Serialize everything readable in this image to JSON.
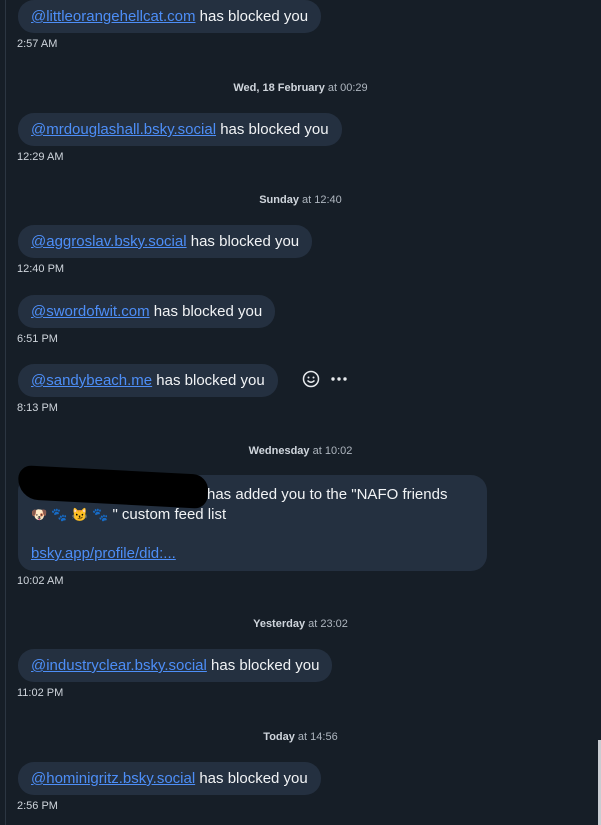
{
  "messages": [
    {
      "handle": "@littleorangehellcat.com",
      "text": " has blocked you",
      "time": "2:57 AM"
    },
    {
      "handle": "@mrdouglashall.bsky.social",
      "text": " has blocked you",
      "time": "12:29 AM"
    },
    {
      "handle": "@aggroslav.bsky.social",
      "text": " has blocked you",
      "time": "12:40 PM"
    },
    {
      "handle": "@swordofwit.com",
      "text": " has blocked you",
      "time": "6:51 PM"
    },
    {
      "handle": "@sandybeach.me",
      "text": " has blocked you",
      "time": "8:13 PM"
    },
    {
      "handle": "@industryclear.bsky.social",
      "text": " has blocked you",
      "time": "11:02 PM"
    },
    {
      "handle": "@hominigritz.bsky.social",
      "text": " has blocked you",
      "time": "2:56 PM"
    }
  ],
  "dividers": [
    {
      "day": "Wed, 18 February",
      "at": " at 00:29"
    },
    {
      "day": "Sunday",
      "at": " at 12:40"
    },
    {
      "day": "Wednesday",
      "at": " at 10:02"
    },
    {
      "day": "Yesterday",
      "at": " at 23:02"
    },
    {
      "day": "Today",
      "at": " at 14:56"
    }
  ],
  "list_message": {
    "line1": "has added you to the \"NAFO friends",
    "emojis": [
      "🐶",
      "🐾",
      "😼",
      "🐾"
    ],
    "line2": "\" custom feed list",
    "link": "bsky.app/profile/did:...",
    "time": "10:02 AM"
  },
  "actions": {
    "emoji": "☺",
    "more": "•••"
  }
}
